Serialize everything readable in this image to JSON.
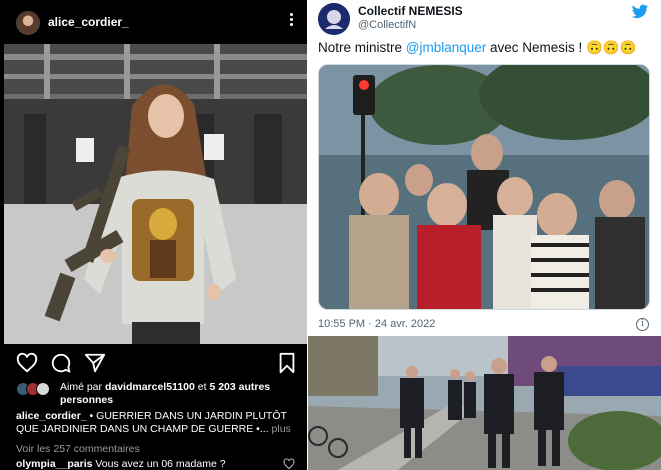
{
  "instagram": {
    "username": "alice_cordier_",
    "likes": {
      "prefix": "Aimé par ",
      "user": "davidmarcel51100",
      "middle": " et ",
      "count": "5 203 autres personnes"
    },
    "caption": {
      "user": "alice_cordier_",
      "text": " • GUERRIER DANS UN JARDIN PLUTÔT QUE JARDINIER DANS UN CHAMP DE GUERRE •...",
      "more": " plus"
    },
    "view_comments": "Voir les 257 commentaires",
    "comment": {
      "user": "olympia__paris",
      "text": " Vous avez un 06 madame ?"
    },
    "icons": [
      "heart-icon",
      "comment-icon",
      "share-icon",
      "bookmark-icon",
      "more-icon"
    ]
  },
  "tweet": {
    "display_name": "Collectif NEMESIS",
    "handle": "@CollectifN",
    "text_before": "Notre ministre ",
    "mention": "@jmblanquer",
    "text_after": " avec Nemesis ! 🙃🙃🙃",
    "timestamp": "10:55 PM · 24 avr. 2022",
    "info_icon": "i",
    "accent_color": "#1d9bf0"
  }
}
